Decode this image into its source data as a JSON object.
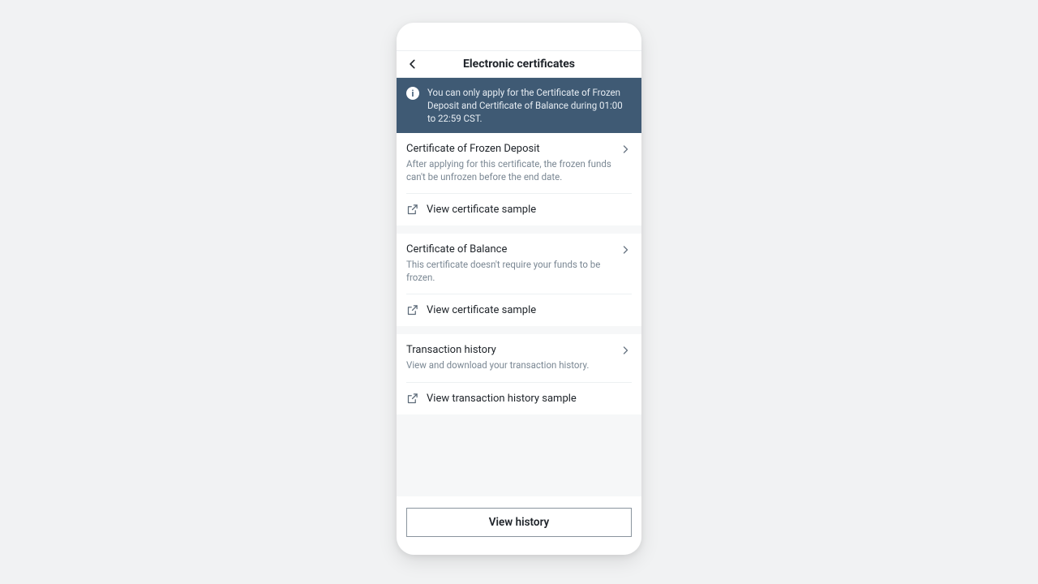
{
  "header": {
    "title": "Electronic certificates"
  },
  "banner": {
    "text": "You can only apply for the Certificate of Frozen Deposit and Certificate of Balance during 01:00 to 22:59 CST."
  },
  "cards": [
    {
      "title": "Certificate of Frozen Deposit",
      "desc": "After applying for this certificate, the frozen funds can't be unfrozen before the end date.",
      "sample_label": "View certificate sample"
    },
    {
      "title": "Certificate of Balance",
      "desc": "This certificate doesn't require your funds to be frozen.",
      "sample_label": "View certificate sample"
    },
    {
      "title": "Transaction history",
      "desc": "View and download your transaction history.",
      "sample_label": "View transaction history sample"
    }
  ],
  "footer": {
    "button_label": "View history"
  }
}
